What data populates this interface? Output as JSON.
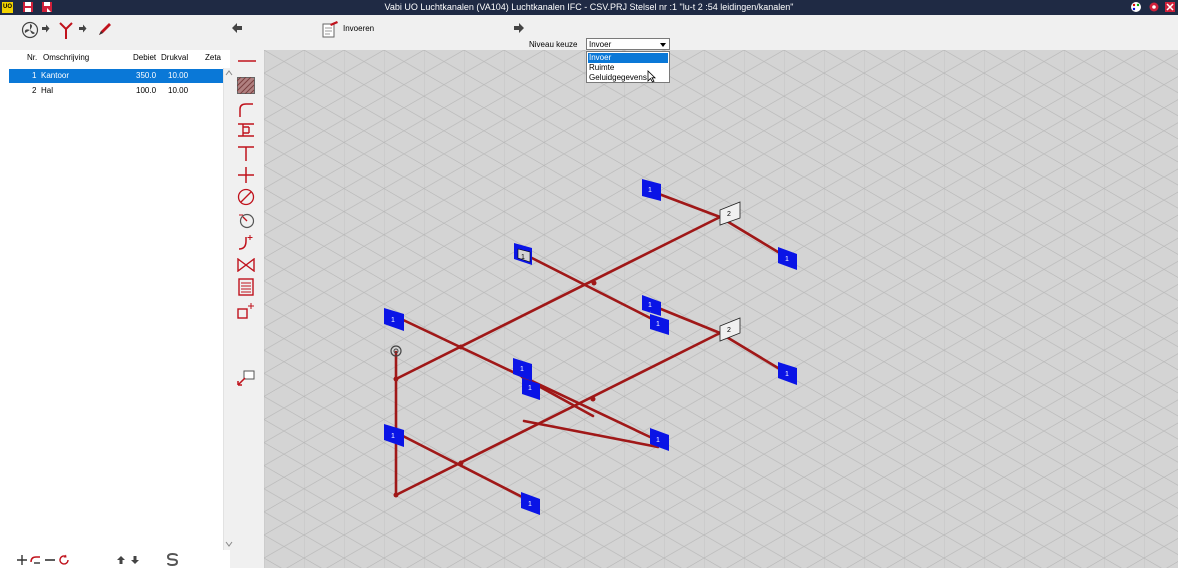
{
  "titlebar": {
    "title": "Vabi UO Luchtkanalen (VA104)  Luchtkanalen IFC - CSV.PRJ    Stelsel nr   :1  \"lu-t 2 :54 leidingen/kanalen\"",
    "app_badge": "UO"
  },
  "toolbar": {
    "invoeren_label": "Invoeren",
    "niveau_label": "Niveau keuze"
  },
  "dropdown": {
    "selected": "Invoer",
    "options": [
      "Invoer",
      "Ruimte",
      "Geluidgegevens"
    ]
  },
  "table": {
    "headers": {
      "nr": "Nr.",
      "omschrijving": "Omschrijving",
      "debiet": "Debiet",
      "drukval": "Drukval",
      "zeta": "Zeta"
    },
    "rows": [
      {
        "nr": "1",
        "omschrijving": "Kantoor",
        "debiet": "350.0",
        "drukval": "10.00"
      },
      {
        "nr": "2",
        "omschrijving": "Hal",
        "debiet": "100.0",
        "drukval": "10.00"
      }
    ]
  },
  "diagram": {
    "labels": {
      "t1": "1",
      "t2": "1",
      "t3": "1",
      "t4": "1",
      "t5": "1",
      "t6": "1",
      "t7": "1",
      "t8": "1",
      "t9": "1",
      "t10": "1",
      "t11": "1",
      "t12": "1",
      "t13": "1",
      "h1": "2",
      "h2": "2"
    }
  },
  "colors": {
    "duct": "#a01818",
    "terminal": "#0a14e6",
    "selection": "#0a78d7",
    "titlebar": "#1f2a44",
    "grid_bg": "#d4d4d4",
    "grid_line": "#b6b6b6"
  },
  "icons": [
    "fan-icon",
    "arrow-right-icon",
    "branch-icon",
    "pencil-icon",
    "arrow-left-icon",
    "invoeren-icon",
    "duct-straight-icon",
    "hatch-icon",
    "bend-icon",
    "reducer-icon",
    "tee-icon",
    "cross-icon",
    "damper-icon",
    "valve-icon",
    "bend-add-icon",
    "bowtie-icon",
    "filter-icon",
    "box-add-icon",
    "pick-icon",
    "add-icon",
    "remove-icon",
    "refresh-icon",
    "move-up-icon",
    "move-down-icon",
    "s-icon",
    "palette-icon",
    "settings-icon",
    "close-icon"
  ]
}
